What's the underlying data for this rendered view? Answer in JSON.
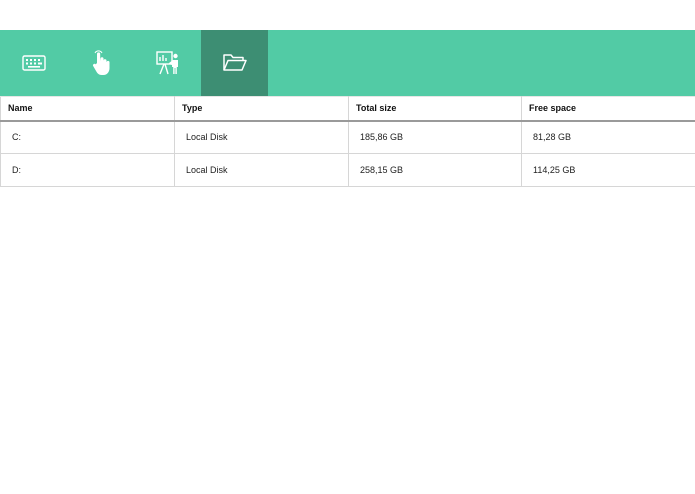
{
  "toolbar": {
    "items": [
      {
        "icon": "keyboard-icon",
        "active": false
      },
      {
        "icon": "touch-hand-icon",
        "active": false
      },
      {
        "icon": "presenter-icon",
        "active": false
      },
      {
        "icon": "folder-open-icon",
        "active": true
      }
    ],
    "color": "#52cba5",
    "active_color": "#3d8e73"
  },
  "table": {
    "headers": [
      "Name",
      "Type",
      "Total size",
      "Free space"
    ],
    "rows": [
      {
        "name": "C:",
        "type": "Local Disk",
        "total": "185,86 GB",
        "free": "81,28 GB"
      },
      {
        "name": "D:",
        "type": "Local Disk",
        "total": "258,15 GB",
        "free": "114,25 GB"
      }
    ]
  }
}
